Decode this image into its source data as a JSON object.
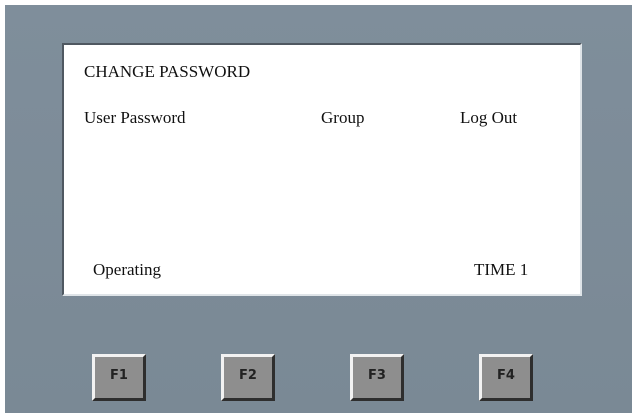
{
  "screen": {
    "title": "CHANGE PASSWORD",
    "menu": [
      "User Password",
      "Group",
      "Log Out"
    ],
    "status": "Operating",
    "time_label": "TIME 1"
  },
  "function_keys": [
    "F1",
    "F2",
    "F3",
    "F4"
  ],
  "colors": {
    "panel": "#7d8c99",
    "screen": "#ffffff",
    "key": "#8e8e8e"
  }
}
